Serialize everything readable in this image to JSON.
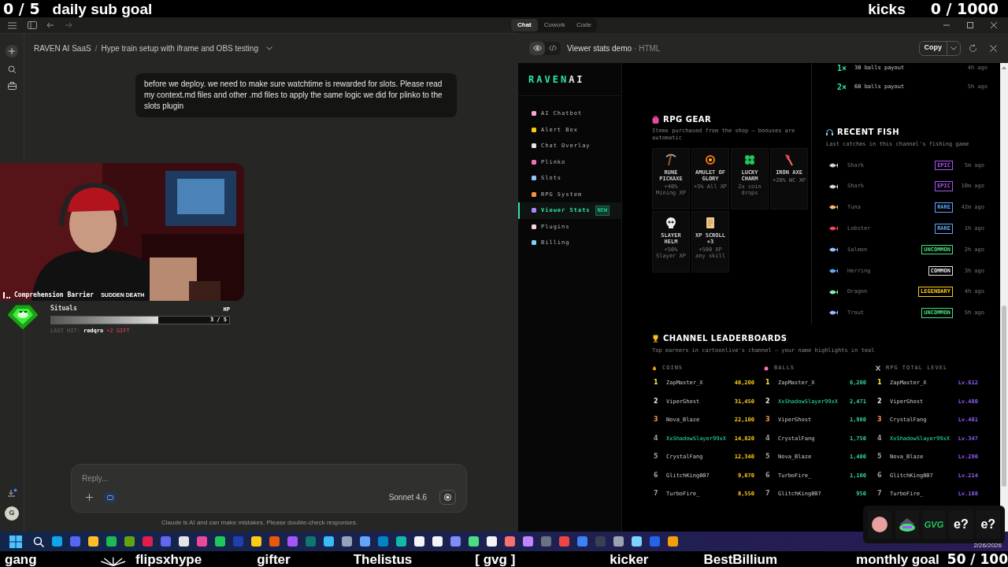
{
  "stream_top": {
    "sub_count": "0 / 5",
    "sub_label": "daily sub goal",
    "kicks_label": "kicks",
    "kicks_count": "0 / 1000"
  },
  "app_tabs": [
    {
      "label": "Chat",
      "selected": true
    },
    {
      "label": "Cowork",
      "selected": false
    },
    {
      "label": "Code",
      "selected": false
    }
  ],
  "breadcrumb": {
    "project": "RAVEN AI SaaS",
    "separator": "/",
    "chat_title": "Hype train setup with iframe and OBS testing"
  },
  "user_message": "before we deploy. we need to make sure watchtime is rewarded for slots. Please read my context.md files and other .md files to apply the same logic we did for plinko to the slots plugin",
  "hype_overlay": {
    "title": "Comprehension Barrier",
    "mode": "SUDDEN DEATH",
    "player": "Situals",
    "hp_label": "HP",
    "level": 0.6,
    "hp_reading": "3 / 5",
    "last_hit_label": "LAST HIT:",
    "last_hit_user": "redqro",
    "last_hit_bonus": "+2 GIFT"
  },
  "composer": {
    "placeholder": "Reply...",
    "model": "Sonnet 4.6"
  },
  "disclaimer": "Claude is AI and can make mistakes. Please double-check responses.",
  "avatar_initial": "G",
  "artifact": {
    "title": "Viewer stats demo",
    "file_type": "· HTML",
    "copy_label": "Copy",
    "logo_a": "RAVEN",
    "logo_b": "AI",
    "nav": [
      {
        "label": "AI Chatbot",
        "selected": false
      },
      {
        "label": "Alert Box",
        "selected": false
      },
      {
        "label": "Chat Overlay",
        "selected": false
      },
      {
        "label": "Plinko",
        "selected": false
      },
      {
        "label": "Slots",
        "selected": false
      },
      {
        "label": "RPG System",
        "selected": false
      },
      {
        "label": "Viewer Stats",
        "selected": true,
        "badge": "NEW"
      },
      {
        "label": "Plugins",
        "selected": false
      },
      {
        "label": "Billing",
        "selected": false
      }
    ],
    "payouts": [
      {
        "multiplier": "1×",
        "text": "30 balls payout",
        "time": "4h ago"
      },
      {
        "multiplier": "2×",
        "text": "60 balls payout",
        "time": "5h ago"
      }
    ],
    "rpg_gear": {
      "title": "RPG GEAR",
      "subtitle": "Items purchased from the shop — bonuses are automatic",
      "items": [
        {
          "kind": "pickaxe",
          "name": "RUNE PICKAXE",
          "bonus": "+40% Mining XP"
        },
        {
          "kind": "amulet",
          "name": "AMULET OF GLORY",
          "bonus": "+5% All XP"
        },
        {
          "kind": "clover",
          "name": "LUCKY CHARM",
          "bonus": "2x coin drops"
        },
        {
          "kind": "axe",
          "name": "IRON AXE",
          "bonus": "+20% WC XP"
        },
        {
          "kind": "skull",
          "name": "SLAYER HELM",
          "bonus": "+50% Slayer XP"
        },
        {
          "kind": "scroll",
          "name": "XP SCROLL +3",
          "bonus": "+500 XP any skill"
        }
      ]
    },
    "recent_fish": {
      "title": "RECENT FISH",
      "subtitle": "Last catches in this channel's fishing game",
      "rows": [
        {
          "name": "Shark",
          "rarity": "EPIC",
          "color": "#a855f7",
          "time": "5m ago"
        },
        {
          "name": "Shark",
          "rarity": "EPIC",
          "color": "#a855f7",
          "time": "10m ago"
        },
        {
          "name": "Tuna",
          "rarity": "RARE",
          "color": "#60a5fa",
          "time": "42m ago"
        },
        {
          "name": "Lobster",
          "rarity": "RARE",
          "color": "#60a5fa",
          "time": "1h ago"
        },
        {
          "name": "Salmon",
          "rarity": "UNCOMMON",
          "color": "#4ade80",
          "time": "2h ago"
        },
        {
          "name": "Herring",
          "rarity": "COMMON",
          "color": "#e5e5e5",
          "time": "3h ago"
        },
        {
          "name": "Dragon",
          "rarity": "LEGENDARY",
          "color": "#facc15",
          "time": "4h ago"
        },
        {
          "name": "Trout",
          "rarity": "UNCOMMON",
          "color": "#4ade80",
          "time": "5h ago"
        }
      ]
    },
    "leaderboards": {
      "title": "CHANNEL LEADERBOARDS",
      "subtitle": "Top earners in cartoonlive's channel — your name highlights in teal",
      "boards": [
        {
          "heading": "COINS",
          "kind": "coins",
          "rows": [
            {
              "rank": "1",
              "name": "ZapMaster_X",
              "value": "48,200",
              "highlighted": false
            },
            {
              "rank": "2",
              "name": "ViperGhost",
              "value": "31,450",
              "highlighted": false
            },
            {
              "rank": "3",
              "name": "Nova_Blaze",
              "value": "22,100",
              "highlighted": false
            },
            {
              "rank": "4",
              "name": "XxShadowSlayer99xX",
              "value": "14,820",
              "highlighted": true
            },
            {
              "rank": "5",
              "name": "CrystalFang",
              "value": "12,340",
              "highlighted": false
            },
            {
              "rank": "6",
              "name": "GlitchKing007",
              "value": "9,870",
              "highlighted": false
            },
            {
              "rank": "7",
              "name": "TurboFire_",
              "value": "8,550",
              "highlighted": false
            }
          ]
        },
        {
          "heading": "BALLS",
          "kind": "balls",
          "rows": [
            {
              "rank": "1",
              "name": "ZapMaster_X",
              "value": "6,200",
              "highlighted": false
            },
            {
              "rank": "2",
              "name": "XxShadowSlayer99xX",
              "value": "2,471",
              "highlighted": true
            },
            {
              "rank": "3",
              "name": "ViperGhost",
              "value": "1,980",
              "highlighted": false
            },
            {
              "rank": "4",
              "name": "CrystalFang",
              "value": "1,750",
              "highlighted": false
            },
            {
              "rank": "5",
              "name": "Nova_Blaze",
              "value": "1,400",
              "highlighted": false
            },
            {
              "rank": "6",
              "name": "TurboFire_",
              "value": "1,100",
              "highlighted": false
            },
            {
              "rank": "7",
              "name": "GlitchKing007",
              "value": "950",
              "highlighted": false
            }
          ]
        },
        {
          "heading": "RPG TOTAL LEVEL",
          "kind": "rpg",
          "rows": [
            {
              "rank": "1",
              "name": "ZapMaster_X",
              "value": "Lv.612",
              "highlighted": false
            },
            {
              "rank": "2",
              "name": "ViperGhost",
              "value": "Lv.480",
              "highlighted": false
            },
            {
              "rank": "3",
              "name": "CrystalFang",
              "value": "Lv.401",
              "highlighted": false
            },
            {
              "rank": "4",
              "name": "XxShadowSlayer99xX",
              "value": "Lv.347",
              "highlighted": true
            },
            {
              "rank": "5",
              "name": "Nova_Blaze",
              "value": "Lv.290",
              "highlighted": false
            },
            {
              "rank": "6",
              "name": "GlitchKing007",
              "value": "Lv.214",
              "highlighted": false
            },
            {
              "rank": "7",
              "name": "TurboFire_",
              "value": "Lv.188",
              "highlighted": false
            }
          ]
        }
      ]
    }
  },
  "emotes": [
    {
      "kind": "face"
    },
    {
      "kind": "frog"
    },
    {
      "kind": "text",
      "text": "GVG"
    },
    {
      "kind": "text",
      "text": "e?"
    },
    {
      "kind": "text",
      "text": "e?"
    }
  ],
  "taskbar": {
    "date": "2/26/2026"
  },
  "stream_bottom": {
    "names": [
      "gang",
      "flipsxhype",
      "gifter",
      "Thelistus",
      "[ gvg ]",
      "kicker",
      "BestBillium"
    ],
    "goal_label": "monthly goal",
    "goal_count": "50 / 100"
  }
}
